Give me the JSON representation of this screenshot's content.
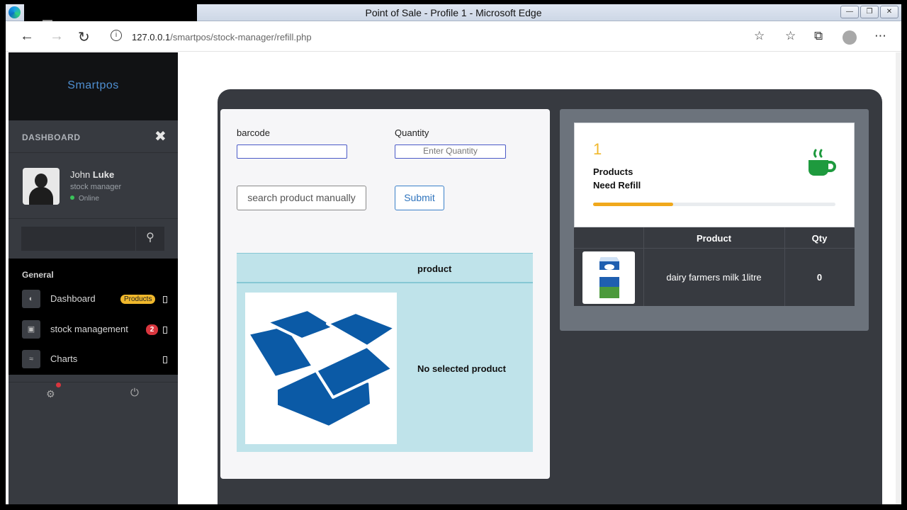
{
  "browser": {
    "window_title": "Point of Sale - Profile 1 - Microsoft Edge",
    "url_host": "127.0.0.1",
    "url_path": "/smartpos/stock-manager/refill.php"
  },
  "sidebar": {
    "brand": "Smartpos",
    "dashboard_label": "DASHBOARD",
    "user": {
      "first_name": "John",
      "last_name": "Luke",
      "role": "stock manager",
      "status": "Online"
    },
    "section_label": "General",
    "items": [
      {
        "label": "Dashboard",
        "badge": "Products"
      },
      {
        "label": "stock management",
        "badge": "2"
      },
      {
        "label": "Charts"
      }
    ]
  },
  "form": {
    "barcode_label": "barcode",
    "quantity_label": "Quantity",
    "barcode_value": "",
    "quantity_placeholder": "Enter Quantity",
    "manual_search_label": "search product manually",
    "submit_label": "Submit",
    "table_header": "product",
    "no_selection_text": "No selected product"
  },
  "refill": {
    "count": "1",
    "line1": "Products",
    "line2": "Need Refill",
    "progress": 0.33,
    "table": {
      "col_product": "Product",
      "col_qty": "Qty",
      "rows": [
        {
          "product": "dairy farmers milk 1litre",
          "qty": "0"
        }
      ]
    }
  },
  "colors": {
    "accent_yellow": "#f0b82c",
    "panel_dark": "#373a40",
    "product_row_bg": "#bfe3ea",
    "cup_green": "#1e9a3e",
    "badge_red": "#d9363e"
  }
}
